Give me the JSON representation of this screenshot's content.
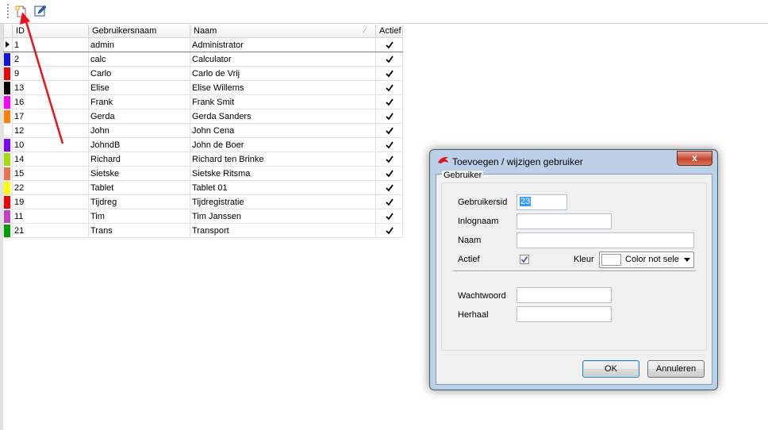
{
  "toolbar": {
    "new_icon": "new-document-icon",
    "edit_icon": "edit-icon"
  },
  "grid": {
    "columns": {
      "id": "ID",
      "username": "Gebruikersnaam",
      "name": "Naam",
      "active": "Actief"
    },
    "rows": [
      {
        "id": "1",
        "username": "admin",
        "name": "Administrator",
        "active": true,
        "color": "#ffffff"
      },
      {
        "id": "2",
        "username": "calc",
        "name": "Calculator",
        "active": true,
        "color": "#1010e0"
      },
      {
        "id": "9",
        "username": "Carlo",
        "name": "Carlo de Vrij",
        "active": true,
        "color": "#ee0000"
      },
      {
        "id": "13",
        "username": "Elise",
        "name": "Elise Willems",
        "active": true,
        "color": "#000000"
      },
      {
        "id": "16",
        "username": "Frank",
        "name": "Frank Smit",
        "active": true,
        "color": "#ff00ff"
      },
      {
        "id": "17",
        "username": "Gerda",
        "name": "Gerda Sanders",
        "active": true,
        "color": "#ff8000"
      },
      {
        "id": "12",
        "username": "John",
        "name": "John Cena",
        "active": true,
        "color": "#ffffff"
      },
      {
        "id": "10",
        "username": "JohndB",
        "name": "John de Boer",
        "active": true,
        "color": "#8000ff"
      },
      {
        "id": "14",
        "username": "Richard",
        "name": "Richard ten Brinke",
        "active": true,
        "color": "#a0e000"
      },
      {
        "id": "15",
        "username": "Sietske",
        "name": "Sietske Ritsma",
        "active": true,
        "color": "#f07050"
      },
      {
        "id": "22",
        "username": "Tablet",
        "name": "Tablet 01",
        "active": true,
        "color": "#ffff00"
      },
      {
        "id": "19",
        "username": "Tijdreg",
        "name": "Tijdregistratie",
        "active": true,
        "color": "#ee0000"
      },
      {
        "id": "11",
        "username": "Tim",
        "name": "Tim Janssen",
        "active": true,
        "color": "#c040c0"
      },
      {
        "id": "21",
        "username": "Trans",
        "name": "Transport",
        "active": true,
        "color": "#00a000"
      }
    ]
  },
  "dialog": {
    "title": "Toevoegen / wijzigen gebruiker",
    "close_label": "x",
    "group_title": "Gebruiker",
    "fields": {
      "userid_label": "Gebruikersid",
      "userid_value": "23",
      "login_label": "Inlognaam",
      "login_value": "",
      "name_label": "Naam",
      "name_value": "",
      "active_label": "Actief",
      "active_checked": true,
      "color_label": "Kleur",
      "color_value": "Color not selected",
      "password_label": "Wachtwoord",
      "password_value": "",
      "repeat_label": "Herhaal",
      "repeat_value": ""
    },
    "ok_label": "OK",
    "cancel_label": "Annuleren"
  }
}
